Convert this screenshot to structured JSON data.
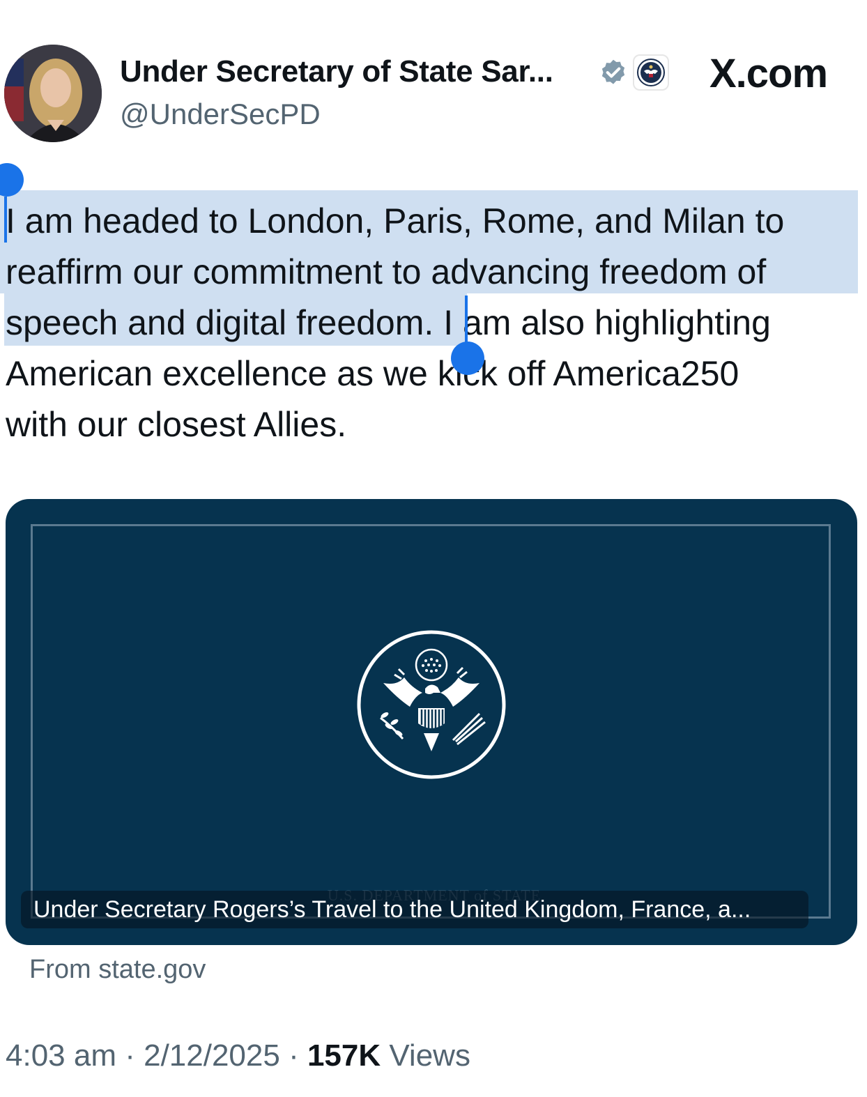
{
  "header": {
    "display_name": "Under Secretary of State Sar...",
    "handle": "@UnderSecPD",
    "site_logo": "X.com",
    "avatar_icon": "profile-photo",
    "verified_icon": "verified-badge-icon",
    "affiliation_icon": "state-department-seal-icon"
  },
  "tweet": {
    "line1": "I am headed to London, Paris, Rome, and Milan to",
    "line2": "reaffirm our commitment to advancing freedom of",
    "line3_selected": "speech and digital freedom.",
    "line3_rest": " I am also highlighting",
    "line4": "American excellence as we kick off America250",
    "line5": "with our closest Allies."
  },
  "card": {
    "dept_text": "U.S. DEPARTMENT of STATE",
    "caption": "Under Secretary Rogers’s Travel to the United Kingdom, France, a...",
    "source": "From state.gov",
    "background_color": "#06334f"
  },
  "meta": {
    "time": "4:03 am",
    "separator": " · ",
    "date": "2/12/2025",
    "views_count": "157K",
    "views_label": " Views"
  },
  "colors": {
    "selection": "#cfdff1",
    "selection_handle": "#1a73e8",
    "secondary_text": "#536471"
  }
}
